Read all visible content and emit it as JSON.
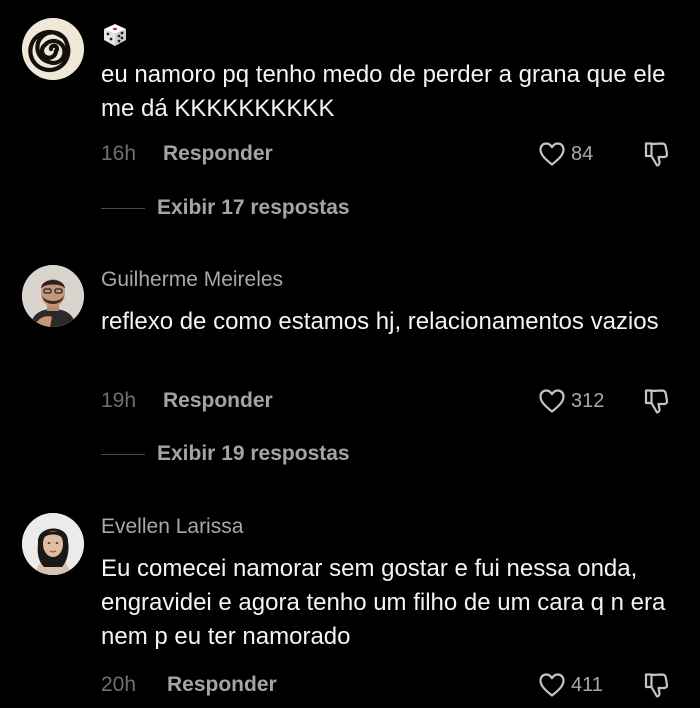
{
  "comments": [
    {
      "username": "",
      "badge_icon": "dice-icon",
      "text": "eu namoro pq tenho medo de perder a grana que ele me dá KKKKKKKKKK",
      "time": "16h",
      "reply_label": "Responder",
      "likes": "84",
      "view_replies": "Exibir 17 respostas"
    },
    {
      "username": "Guilherme Meireles",
      "text": "reflexo de como estamos hj, relacionamentos vazios",
      "time": "19h",
      "reply_label": "Responder",
      "likes": "312",
      "view_replies": "Exibir 19 respostas"
    },
    {
      "username": "Evellen Larissa",
      "text": "Eu comecei namorar sem gostar e fui nessa onda, engravidei e agora tenho um filho de um cara q n era nem p eu ter namorado",
      "time": "20h",
      "reply_label": "Responder",
      "likes": "411"
    }
  ],
  "colors": {
    "background": "#000000",
    "text": "#f4f4f4",
    "muted": "#a8a8a8",
    "time": "#6f6f6f"
  }
}
